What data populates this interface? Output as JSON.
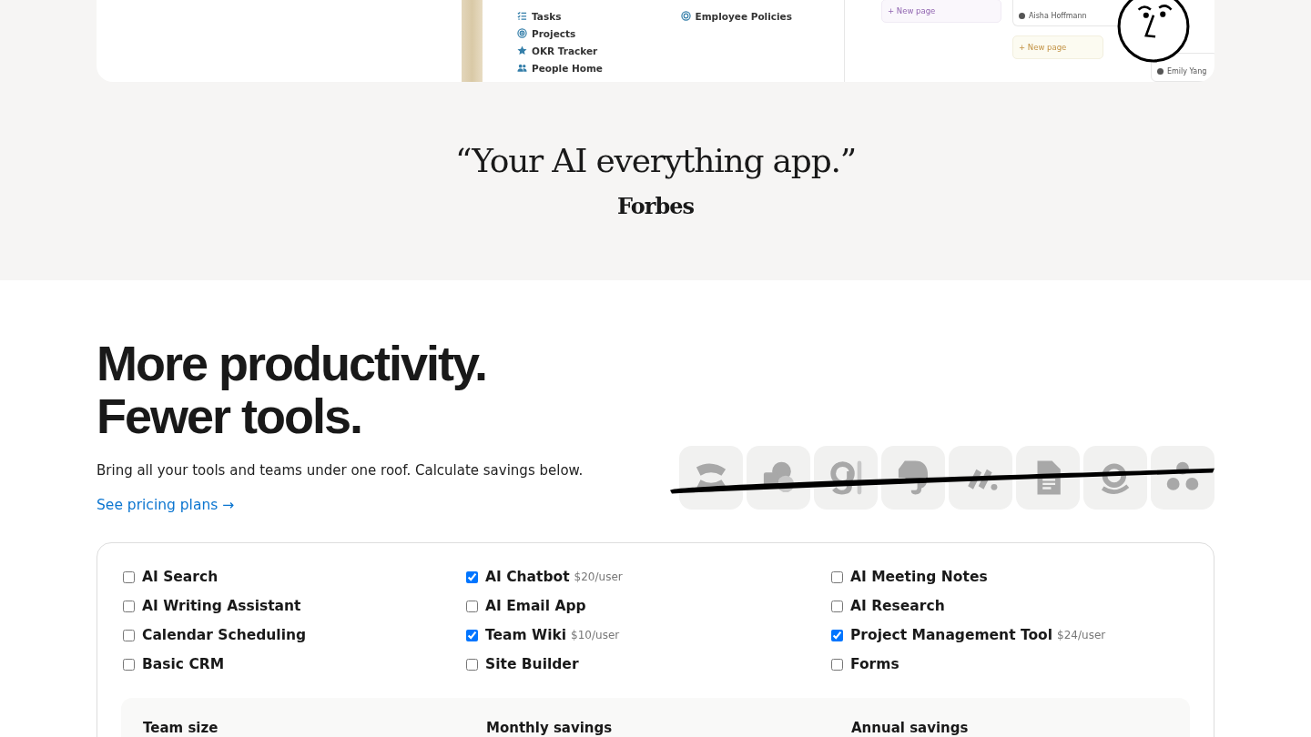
{
  "preview": {
    "links": [
      {
        "label": "Tasks"
      },
      {
        "label": "Projects"
      },
      {
        "label": "OKR Tracker"
      },
      {
        "label": "People Home"
      }
    ],
    "side_links": [
      {
        "label": "Employee Policies"
      }
    ],
    "new_page_buttons": [
      {
        "label": "+ New page",
        "color": "#9065b0"
      },
      {
        "label": "+ New page",
        "color": "#c29243"
      }
    ],
    "assignees": [
      {
        "name": "Aisha Hoffmann"
      },
      {
        "name": "Emily Yang"
      }
    ]
  },
  "quote": {
    "text": "“Your AI everything app.”",
    "source": "Forbes"
  },
  "hero": {
    "title_lines": [
      "More productivity.",
      "Fewer tools."
    ],
    "subtitle": "Bring all your tools and teams under one roof. Calculate savings below.",
    "link": "See pricing plans →"
  },
  "calculator": {
    "options": [
      {
        "label": "AI Search",
        "checked": false
      },
      {
        "label": "AI Chatbot",
        "price": "$20/user",
        "checked": true
      },
      {
        "label": "AI Meeting Notes",
        "checked": false
      },
      {
        "label": "AI Writing Assistant",
        "checked": false
      },
      {
        "label": "AI Email App",
        "checked": false
      },
      {
        "label": "AI Research",
        "checked": false
      },
      {
        "label": "Calendar Scheduling",
        "checked": false
      },
      {
        "label": "Team Wiki",
        "price": "$10/user",
        "checked": true
      },
      {
        "label": "Project Management Tool",
        "price": "$24/user",
        "checked": true
      },
      {
        "label": "Basic CRM",
        "checked": false
      },
      {
        "label": "Site Builder",
        "checked": false
      },
      {
        "label": "Forms",
        "checked": false
      }
    ],
    "summary_labels": [
      "Team size",
      "Monthly savings",
      "Annual savings"
    ]
  }
}
